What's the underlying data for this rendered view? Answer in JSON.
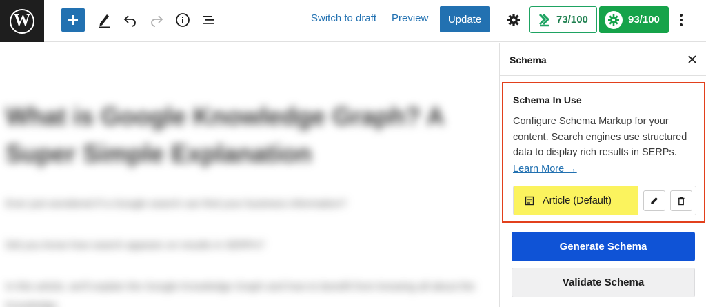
{
  "toolbar": {
    "logo_glyph": "W",
    "add_icon": "plus-icon",
    "tools": [
      "pencil-icon",
      "undo-icon",
      "redo-icon",
      "info-icon",
      "list-view-icon"
    ],
    "switch_to_draft": "Switch to draft",
    "preview": "Preview",
    "update": "Update",
    "settings_icon": "gear-icon",
    "score_primary": "73/100",
    "score_secondary": "93/100",
    "more_icon": "kebab-icon",
    "accent_color": "#2271b1"
  },
  "editor": {
    "title": "What is Google Knowledge Graph? A Super Simple Explanation",
    "paragraphs": [
      "Ever just wondered if a Google search can find your business information?",
      "Did you know how search appears on results in SERPs?",
      "In this article, we'll explain the Google Knowledge Graph and how to benefit from knowing all about the Knowledge."
    ]
  },
  "sidebar": {
    "title": "Schema",
    "close_icon": "close-icon",
    "panel": {
      "title": "Schema In Use",
      "description": "Configure Schema Markup for your content. Search engines use structured data to display rich results in SERPs.",
      "learn_more": "Learn More →",
      "item_label": "Article (Default)",
      "item_icon": "document-icon",
      "edit_icon": "pencil-icon",
      "delete_icon": "trash-icon",
      "highlight_color": "#fbf35e",
      "border_color": "#e2401c"
    },
    "generate_label": "Generate Schema",
    "validate_label": "Validate Schema"
  }
}
